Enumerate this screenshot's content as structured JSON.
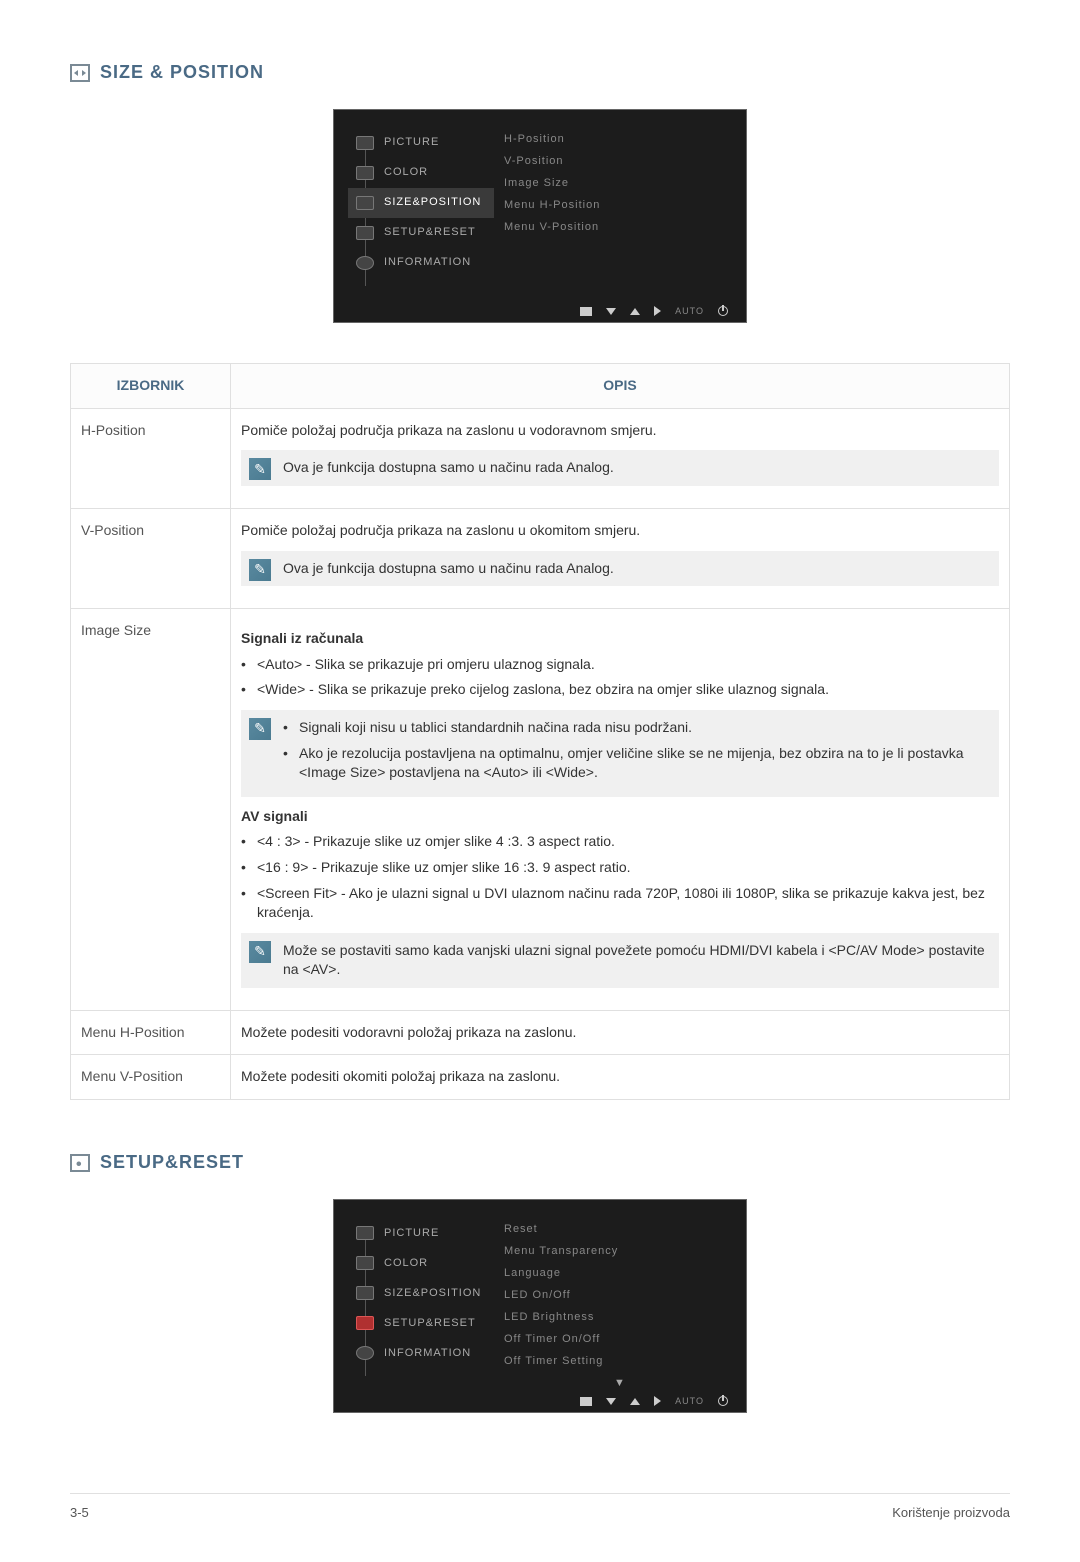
{
  "section1": {
    "title": "SIZE & POSITION",
    "osd": {
      "left": [
        {
          "label": "PICTURE",
          "sel": false,
          "hot": false
        },
        {
          "label": "COLOR",
          "sel": false,
          "hot": false
        },
        {
          "label": "SIZE&POSITION",
          "sel": true,
          "hot": false
        },
        {
          "label": "SETUP&RESET",
          "sel": false,
          "hot": false
        },
        {
          "label": "INFORMATION",
          "sel": false,
          "hot": false,
          "info": true
        }
      ],
      "right": [
        "H-Position",
        "V-Position",
        "Image Size",
        "Menu H-Position",
        "Menu V-Position"
      ],
      "footer_auto": "AUTO"
    }
  },
  "table": {
    "header_menu": "IZBORNIK",
    "header_desc": "OPIS",
    "rows": [
      {
        "menu": "H-Position",
        "desc": "Pomiče položaj područja prikaza na zaslonu u vodoravnom smjeru.",
        "note": "Ova je funkcija dostupna samo u načinu rada Analog."
      },
      {
        "menu": "V-Position",
        "desc": "Pomiče položaj područja prikaza na zaslonu u okomitom smjeru.",
        "note": "Ova je funkcija dostupna samo u načinu rada Analog."
      },
      {
        "menu": "Image Size",
        "pc_heading": "Signali iz računala",
        "pc_b1": "<Auto> - Slika se prikazuje pri omjeru ulaznog signala.",
        "pc_b2": "<Wide> - Slika se prikazuje preko cijelog zaslona, bez obzira na omjer slike ulaznog signala.",
        "pc_note_b1": "Signali koji nisu u tablici standardnih načina rada nisu podržani.",
        "pc_note_b2": "Ako je rezolucija postavljena na optimalnu, omjer veličine slike se ne mijenja, bez obzira na to je li postavka <Image Size> postavljena na <Auto> ili <Wide>.",
        "av_heading": "AV signali",
        "av_b1": "<4 : 3> - Prikazuje slike uz omjer slike 4 :3. 3 aspect ratio.",
        "av_b2": "<16 : 9> - Prikazuje slike uz omjer slike 16 :3. 9 aspect ratio.",
        "av_b3": "<Screen Fit> - Ako je ulazni signal u DVI ulaznom načinu rada 720P, 1080i ili 1080P, slika se prikazuje kakva jest, bez kraćenja.",
        "av_note": "Može se postaviti samo kada vanjski ulazni signal povežete pomoću HDMI/DVI kabela i <PC/AV Mode> postavite na <AV>."
      },
      {
        "menu": "Menu H-Position",
        "desc": "Možete podesiti vodoravni položaj prikaza na zaslonu."
      },
      {
        "menu": "Menu V-Position",
        "desc": "Možete podesiti okomiti položaj prikaza na zaslonu."
      }
    ]
  },
  "section2": {
    "title": "SETUP&RESET",
    "osd": {
      "left": [
        {
          "label": "PICTURE"
        },
        {
          "label": "COLOR"
        },
        {
          "label": "SIZE&POSITION"
        },
        {
          "label": "SETUP&RESET",
          "hot": true
        },
        {
          "label": "INFORMATION",
          "info": true
        }
      ],
      "right": [
        "Reset",
        "Menu Transparency",
        "Language",
        "LED On/Off",
        "LED Brightness",
        "Off Timer On/Off",
        "Off Timer Setting"
      ],
      "footer_auto": "AUTO"
    }
  },
  "footer": {
    "left": "3-5",
    "right": "Korištenje proizvoda"
  }
}
